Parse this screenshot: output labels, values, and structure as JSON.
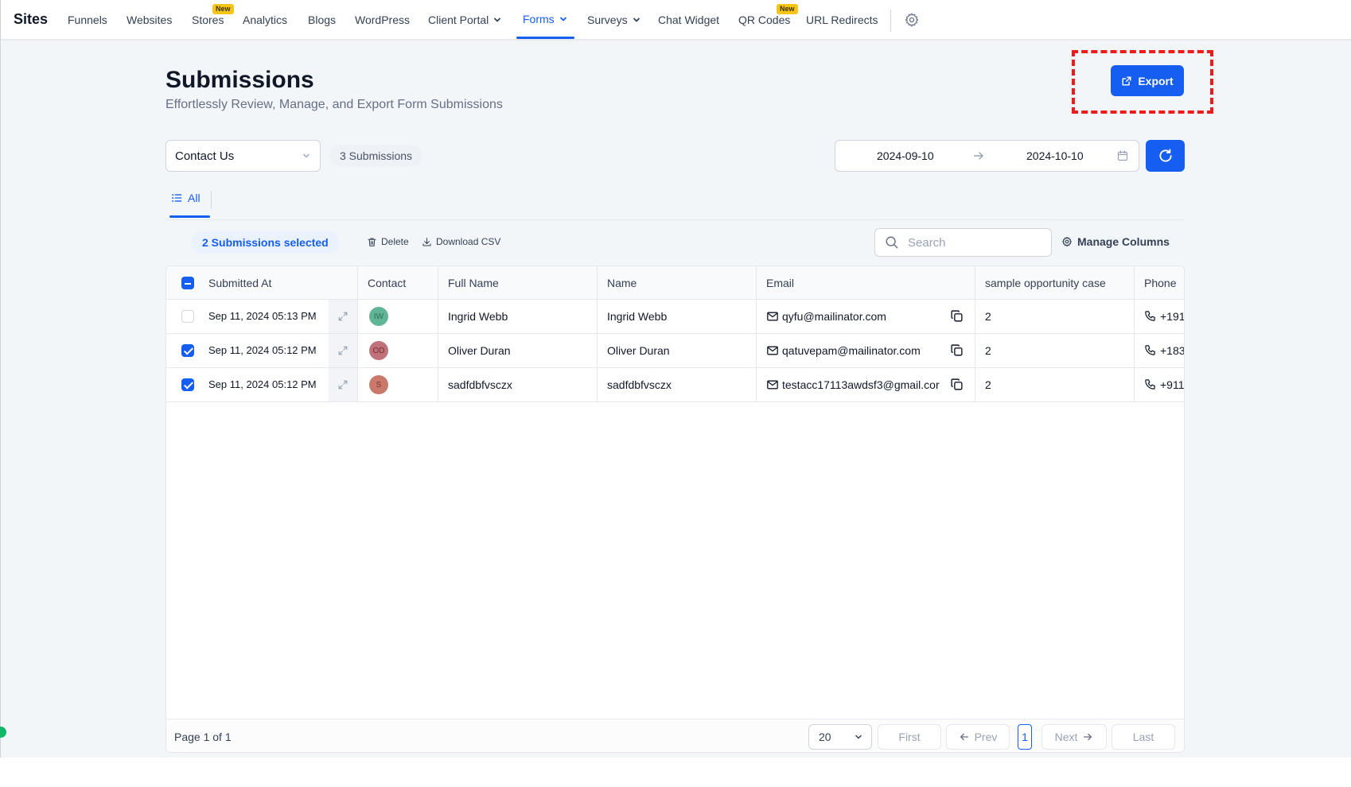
{
  "nav": {
    "brand": "Sites",
    "items": [
      {
        "label": "Funnels"
      },
      {
        "label": "Websites"
      },
      {
        "label": "Stores",
        "badge": "New"
      },
      {
        "label": "Analytics"
      },
      {
        "label": "Blogs"
      },
      {
        "label": "WordPress"
      },
      {
        "label": "Client Portal",
        "dropdown": true
      },
      {
        "label": "Forms",
        "dropdown": true,
        "active": true
      },
      {
        "label": "Surveys",
        "dropdown": true
      },
      {
        "label": "Chat Widget"
      },
      {
        "label": "QR Codes",
        "badge": "New"
      },
      {
        "label": "URL Redirects"
      }
    ],
    "settings_icon": "gear-icon"
  },
  "header": {
    "title": "Submissions",
    "subtitle": "Effortlessly Review, Manage, and Export Form Submissions",
    "export_label": "Export",
    "export_icon": "external-link-icon"
  },
  "filters": {
    "form_selected": "Contact Us",
    "submission_count": "3 Submissions",
    "date_start": "2024-09-10",
    "date_end": "2024-10-10",
    "refresh_icon": "refresh-icon"
  },
  "tabs": [
    {
      "label": "All",
      "icon": "list-icon",
      "active": true
    }
  ],
  "bulk": {
    "selected_label": "2 Submissions selected",
    "delete_label": "Delete",
    "download_label": "Download CSV",
    "search_placeholder": "Search",
    "manage_columns_label": "Manage Columns"
  },
  "table": {
    "columns": [
      "Submitted At",
      "Contact",
      "Full Name",
      "Name",
      "Email",
      "sample opportunity case",
      "Phone"
    ],
    "rows": [
      {
        "checked": false,
        "submitted_at": "Sep 11, 2024  05:13 PM",
        "contact_initials": "IW",
        "avatar_color": "#5fb596",
        "full_name": "Ingrid Webb",
        "name": "Ingrid Webb",
        "email": "qyfu@mailinator.com",
        "opportunity": "2",
        "phone": "+191"
      },
      {
        "checked": true,
        "submitted_at": "Sep 11, 2024  05:12 PM",
        "contact_initials": "OD",
        "avatar_color": "#c1717a",
        "full_name": "Oliver Duran",
        "name": "Oliver Duran",
        "email": "qatuvepam@mailinator.com",
        "opportunity": "2",
        "phone": "+183"
      },
      {
        "checked": true,
        "submitted_at": "Sep 11, 2024  05:12 PM",
        "contact_initials": "S",
        "avatar_color": "#c9786a",
        "full_name": "sadfdbfvsczx",
        "name": "sadfdbfvsczx",
        "email": "testacc17113awdsf3@gmail.cor",
        "opportunity": "2",
        "phone": "+911"
      }
    ]
  },
  "pagination": {
    "page_info": "Page 1 of 1",
    "per_page": "20",
    "first": "First",
    "prev": "Prev",
    "current": "1",
    "next": "Next",
    "last": "Last"
  },
  "colors": {
    "accent": "#155eef",
    "highlight": "#ee1b1b",
    "badge": "#f5c518"
  }
}
